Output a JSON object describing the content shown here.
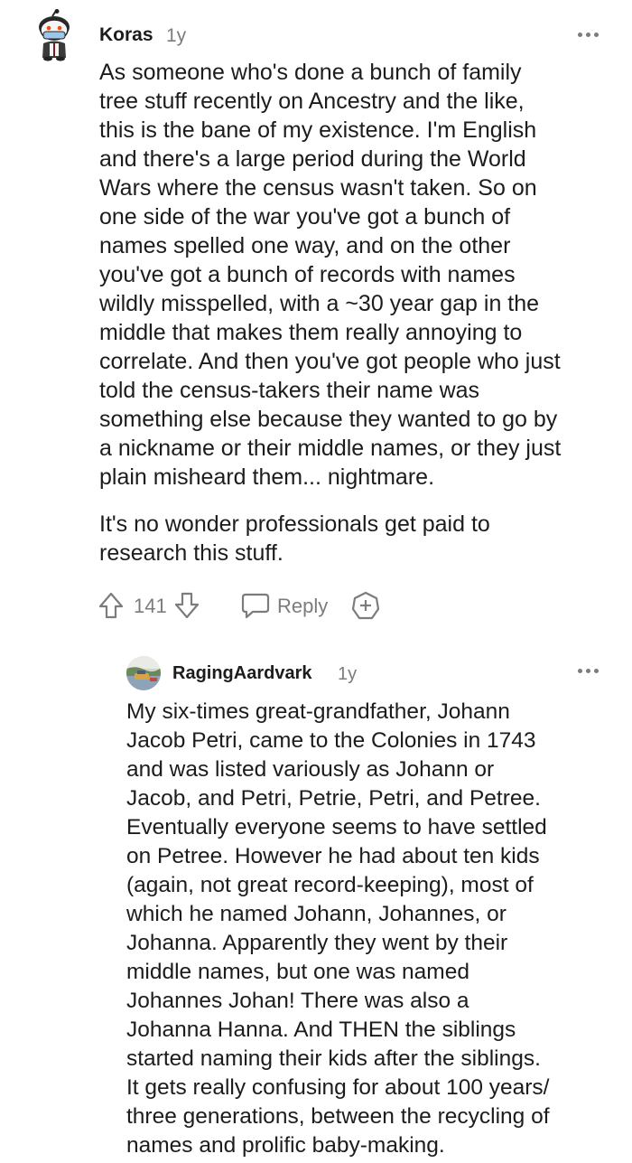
{
  "comment": {
    "username": "Koras",
    "age": "1y",
    "paragraphs": [
      [
        "As someone who's done a bunch of family",
        "tree stuff recently on Ancestry and the like,",
        "this is the bane of my existence. I'm English",
        "and there's a large period during the World",
        "Wars where the census wasn't taken. So on",
        "one side of the war you've got a bunch of",
        "names spelled one way, and on the other",
        "you've got a bunch of records with names",
        "wildly misspelled, with a ~30 year gap in the",
        "middle that makes them really annoying to",
        "correlate. And then you've got people who just",
        "told the census-takers their name was",
        "something else because they wanted to go by",
        "a nickname or their middle names, or they just",
        "plain misheard them... nightmare."
      ],
      [
        "It's no wonder professionals get paid to",
        "research this stuff."
      ]
    ],
    "vote_count": "141",
    "reply_label": "Reply",
    "icons": {
      "upvote": "arrow-up-outline-icon",
      "downvote": "arrow-down-outline-icon",
      "reply": "speech-bubble-icon",
      "award": "award-plus-icon",
      "more": "more-dots-icon"
    }
  },
  "reply": {
    "username": "RagingAardvark",
    "age": "1y",
    "paragraphs": [
      [
        "My six-times great-grandfather, Johann",
        "Jacob Petri, came to the Colonies in 1743",
        "and was listed variously as Johann or",
        "Jacob, and Petri, Petrie, Petri, and Petree.",
        "Eventually everyone seems to have settled",
        "on Petree. However he had about ten kids",
        "(again, not great record-keeping), most of",
        "which he named Johann, Johannes, or",
        "Johanna. Apparently they went by their",
        "middle names, but one was named",
        "Johannes Johan! There was also a",
        "Johanna Hanna. And THEN the siblings",
        "started naming their kids after the siblings.",
        "It gets really confusing for about 100 years/",
        "three generations, between the recycling of",
        "names and prolific baby-making."
      ]
    ]
  },
  "colors": {
    "text": "#1c1c1c",
    "meta": "#7c7c7c",
    "background": "#ffffff"
  }
}
